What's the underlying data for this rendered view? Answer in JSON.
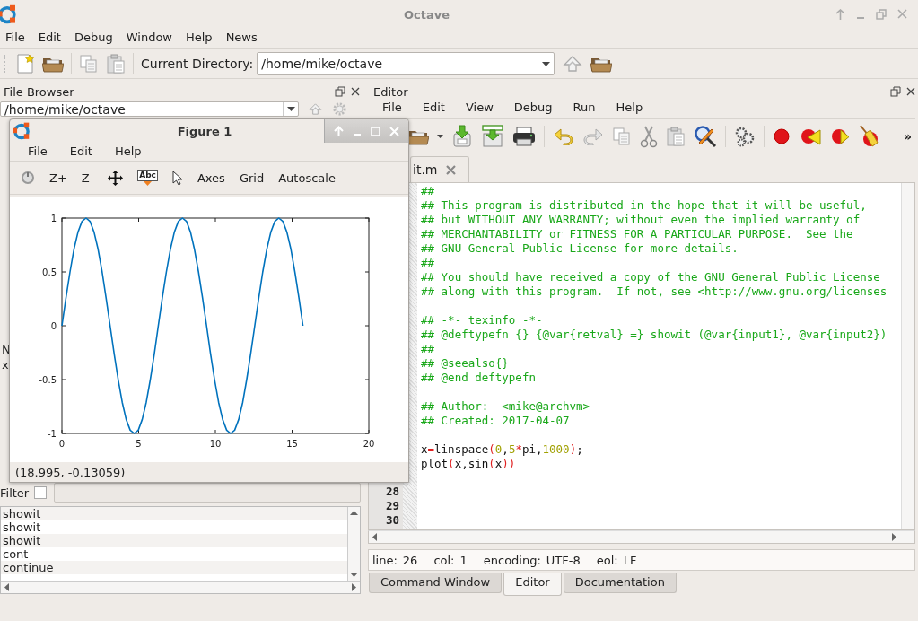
{
  "window": {
    "title": "Octave"
  },
  "menu": [
    "File",
    "Edit",
    "Debug",
    "Window",
    "Help",
    "News"
  ],
  "toolbar": {
    "current_directory_label": "Current Directory:",
    "current_directory": "/home/mike/octave"
  },
  "file_browser": {
    "title": "File Browser",
    "path": "/home/mike/octave"
  },
  "hidden_panel_fragments": [
    "N",
    "x"
  ],
  "command_history": {
    "filter": {
      "label": "Filter",
      "checked": false
    },
    "items": [
      "showit",
      "showit",
      "showit",
      "cont",
      "continue"
    ]
  },
  "editor": {
    "title": "Editor",
    "menu": [
      "File",
      "Edit",
      "View",
      "Debug",
      "Run",
      "Help"
    ],
    "toolbar_overflow": "»",
    "tabs": [
      {
        "label": "it.m",
        "selected": true
      }
    ],
    "line_numbers": [
      "28",
      "29",
      "30"
    ],
    "lines": [
      {
        "kind": "comment",
        "text": "##"
      },
      {
        "kind": "comment",
        "text": "## This program is distributed in the hope that it will be useful,"
      },
      {
        "kind": "comment",
        "text": "## but WITHOUT ANY WARRANTY; without even the implied warranty of"
      },
      {
        "kind": "comment",
        "text": "## MERCHANTABILITY or FITNESS FOR A PARTICULAR PURPOSE.  See the"
      },
      {
        "kind": "comment",
        "text": "## GNU General Public License for more details."
      },
      {
        "kind": "comment",
        "text": "##"
      },
      {
        "kind": "comment",
        "text": "## You should have received a copy of the GNU General Public License"
      },
      {
        "kind": "comment",
        "text": "## along with this program.  If not, see <http://www.gnu.org/licenses"
      },
      {
        "kind": "blank"
      },
      {
        "kind": "comment",
        "text": "## -*- texinfo -*-"
      },
      {
        "kind": "comment",
        "text": "## @deftypefn {} {@var{retval} =} showit (@var{input1}, @var{input2})"
      },
      {
        "kind": "comment",
        "text": "##"
      },
      {
        "kind": "comment",
        "text": "## @seealso{}"
      },
      {
        "kind": "comment",
        "text": "## @end deftypefn"
      },
      {
        "kind": "blank"
      },
      {
        "kind": "comment",
        "text": "## Author:  <mike@archvm>"
      },
      {
        "kind": "comment",
        "text": "## Created: 2017-04-07"
      },
      {
        "kind": "blank"
      },
      {
        "kind": "code",
        "tokens": [
          {
            "kind": "plain",
            "text": "x"
          },
          {
            "kind": "operator",
            "text": "="
          },
          {
            "kind": "plain",
            "text": "linspace"
          },
          {
            "kind": "operator",
            "text": "("
          },
          {
            "kind": "number",
            "text": "0"
          },
          {
            "kind": "plain",
            "text": ","
          },
          {
            "kind": "number",
            "text": "5"
          },
          {
            "kind": "operator",
            "text": "*"
          },
          {
            "kind": "plain",
            "text": "pi"
          },
          {
            "kind": "plain",
            "text": ","
          },
          {
            "kind": "number",
            "text": "1000"
          },
          {
            "kind": "operator",
            "text": ")"
          },
          {
            "kind": "plain",
            "text": ";"
          }
        ]
      },
      {
        "kind": "code",
        "tokens": [
          {
            "kind": "plain",
            "text": "plot"
          },
          {
            "kind": "operator",
            "text": "("
          },
          {
            "kind": "plain",
            "text": "x,sin"
          },
          {
            "kind": "operator",
            "text": "("
          },
          {
            "kind": "plain",
            "text": "x"
          },
          {
            "kind": "operator",
            "text": "))"
          }
        ]
      }
    ],
    "status": [
      {
        "label": "line:",
        "value": "26"
      },
      {
        "label": "col:",
        "value": "1"
      },
      {
        "label": "encoding:",
        "value": "UTF-8"
      },
      {
        "label": "eol:",
        "value": "LF"
      }
    ]
  },
  "bottom_tabs": [
    {
      "label": "Command Window",
      "selected": false
    },
    {
      "label": "Editor",
      "selected": true
    },
    {
      "label": "Documentation",
      "selected": false
    }
  ],
  "figure": {
    "title": "Figure 1",
    "menu": [
      "File",
      "Edit",
      "Help"
    ],
    "toolbar": {
      "zoom_in": "Z+",
      "zoom_out": "Z-",
      "text_tool": "Abc",
      "axes": "Axes",
      "grid": "Grid",
      "autoscale": "Autoscale"
    },
    "status": "(18.995, -0.13059)",
    "chart_data": {
      "type": "line",
      "xlim": [
        0,
        20
      ],
      "ylim": [
        -1,
        1
      ],
      "xticks": [
        0,
        5,
        10,
        15,
        20
      ],
      "yticks": [
        -1,
        -0.5,
        0,
        0.5,
        1
      ],
      "x": [
        0,
        0.262,
        0.524,
        0.785,
        1.047,
        1.309,
        1.571,
        1.833,
        2.094,
        2.356,
        2.618,
        2.88,
        3.142,
        3.403,
        3.665,
        3.927,
        4.189,
        4.451,
        4.712,
        4.974,
        5.236,
        5.498,
        5.76,
        6.021,
        6.283,
        6.545,
        6.807,
        7.069,
        7.33,
        7.592,
        7.854,
        8.116,
        8.378,
        8.639,
        8.901,
        9.163,
        9.425,
        9.687,
        9.948,
        10.21,
        10.472,
        10.734,
        10.996,
        11.257,
        11.519,
        11.781,
        12.043,
        12.305,
        12.566,
        12.828,
        13.09,
        13.352,
        13.614,
        13.875,
        14.137,
        14.399,
        14.661,
        14.923,
        15.184,
        15.446,
        15.708
      ],
      "series": [
        {
          "color": "#0072bd",
          "values": [
            0,
            0.26,
            0.5,
            0.71,
            0.87,
            0.97,
            1,
            0.97,
            0.87,
            0.71,
            0.5,
            0.26,
            0,
            -0.26,
            -0.5,
            -0.71,
            -0.87,
            -0.97,
            -1,
            -0.97,
            -0.87,
            -0.71,
            -0.5,
            -0.26,
            0,
            0.26,
            0.5,
            0.71,
            0.87,
            0.97,
            1,
            0.97,
            0.87,
            0.71,
            0.5,
            0.26,
            0,
            -0.26,
            -0.5,
            -0.71,
            -0.87,
            -0.97,
            -1,
            -0.97,
            -0.87,
            -0.71,
            -0.5,
            -0.26,
            0,
            0.26,
            0.5,
            0.71,
            0.87,
            0.97,
            1,
            0.97,
            0.87,
            0.71,
            0.5,
            0.26,
            0
          ]
        }
      ]
    }
  }
}
